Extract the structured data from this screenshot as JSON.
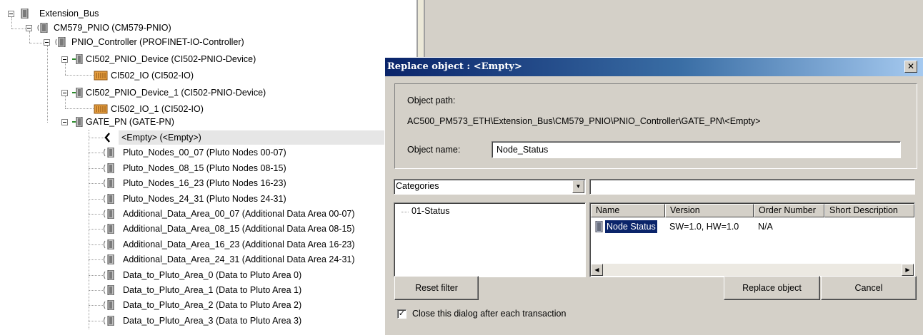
{
  "tree": {
    "root": "Extension_Bus",
    "cm579": "CM579_PNIO (CM579-PNIO)",
    "controller": "PNIO_Controller (PROFINET-IO-Controller)",
    "device1": "CI502_PNIO_Device (CI502-PNIO-Device)",
    "io1": "CI502_IO (CI502-IO)",
    "device2": "CI502_PNIO_Device_1 (CI502-PNIO-Device)",
    "io2": "CI502_IO_1 (CI502-IO)",
    "gate": "GATE_PN (GATE-PN)",
    "gate_children": [
      "<Empty> (<Empty>)",
      "Pluto_Nodes_00_07 (Pluto Nodes 00-07)",
      "Pluto_Nodes_08_15 (Pluto Nodes 08-15)",
      "Pluto_Nodes_16_23 (Pluto Nodes 16-23)",
      "Pluto_Nodes_24_31 (Pluto Nodes 24-31)",
      "Additional_Data_Area_00_07 (Additional Data Area 00-07)",
      "Additional_Data_Area_08_15 (Additional Data Area 08-15)",
      "Additional_Data_Area_16_23 (Additional Data Area 16-23)",
      "Additional_Data_Area_24_31 (Additional Data Area 24-31)",
      "Data_to_Pluto_Area_0 (Data to Pluto Area 0)",
      "Data_to_Pluto_Area_1 (Data to Pluto Area 1)",
      "Data_to_Pluto_Area_2 (Data to Pluto Area 2)",
      "Data_to_Pluto_Area_3 (Data to Pluto Area 3)"
    ]
  },
  "dialog": {
    "title": "Replace object : <Empty>",
    "close_glyph": "✕",
    "object_path_label": "Object path:",
    "object_path": "AC500_PM573_ETH\\Extension_Bus\\CM579_PNIO\\PNIO_Controller\\GATE_PN\\<Empty>",
    "object_name_label": "Object name:",
    "object_name_value": "Node_Status",
    "categories_selected": "Categories",
    "filter_value": "",
    "category_items": [
      "01-Status"
    ],
    "columns": [
      "Name",
      "Version",
      "Order Number",
      "Short Description"
    ],
    "rows": [
      {
        "name": "Node Status",
        "version": "SW=1.0, HW=1.0",
        "order_number": "N/A",
        "short_description": ""
      }
    ],
    "reset_filter_label": "Reset filter",
    "replace_object_label": "Replace object",
    "cancel_label": "Cancel",
    "close_after_label": "Close this dialog after each transaction",
    "close_after_checked": true
  },
  "colors": {
    "title_gradient_start": "#0a246a",
    "title_gradient_end": "#a6caf0",
    "dialog_face": "#d4d0c8",
    "selection": "#0a246a"
  }
}
